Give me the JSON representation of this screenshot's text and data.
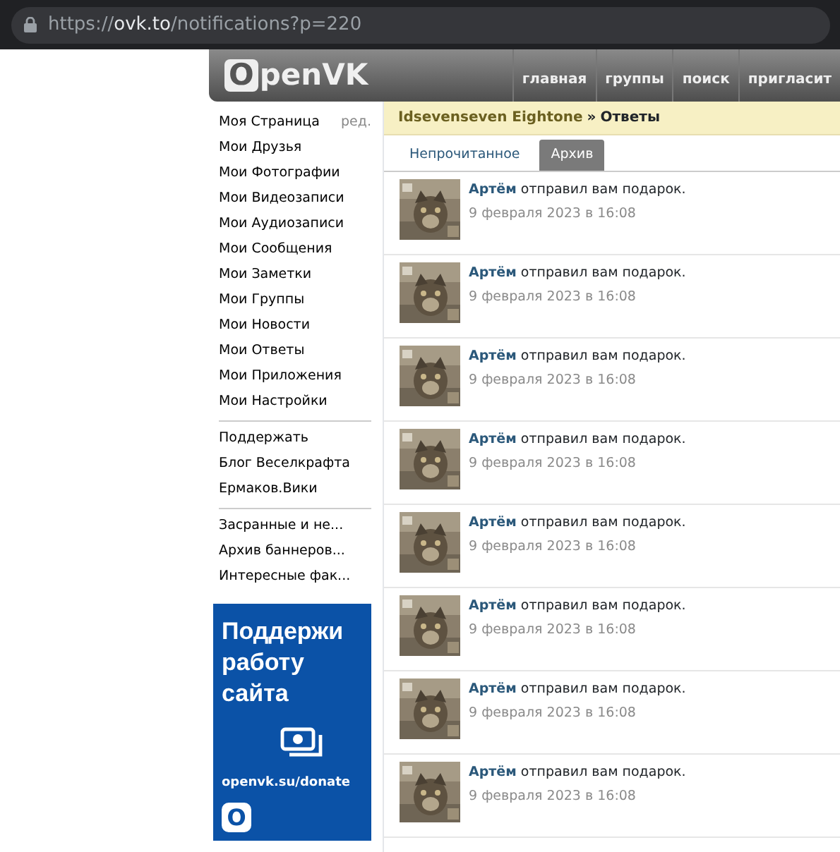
{
  "browser": {
    "url": {
      "scheme": "https://",
      "host": "ovk.to",
      "path": "/notifications?p=220"
    }
  },
  "header": {
    "logo": "OpenVK",
    "nav": [
      {
        "label": "главная"
      },
      {
        "label": "группы"
      },
      {
        "label": "поиск"
      },
      {
        "label": "пригласит"
      }
    ]
  },
  "sidebar": {
    "groups": [
      [
        {
          "label": "Моя Страница",
          "edit": "ред."
        },
        {
          "label": "Мои Друзья"
        },
        {
          "label": "Мои Фотографии"
        },
        {
          "label": "Мои Видеозаписи"
        },
        {
          "label": "Мои Аудиозаписи"
        },
        {
          "label": "Мои Сообщения"
        },
        {
          "label": "Мои Заметки"
        },
        {
          "label": "Мои Группы"
        },
        {
          "label": "Мои Новости"
        },
        {
          "label": "Мои Ответы"
        },
        {
          "label": "Мои Приложения"
        },
        {
          "label": "Мои Настройки"
        }
      ],
      [
        {
          "label": "Поддержать"
        },
        {
          "label": "Блог Веселкрафта"
        },
        {
          "label": "Ермаков.Вики"
        }
      ],
      [
        {
          "label": "Засранные и не..."
        },
        {
          "label": "Архив баннеров..."
        },
        {
          "label": "Интересные фак..."
        }
      ]
    ],
    "banner": {
      "title": "Поддержи работу сайта",
      "url": "openvk.su/donate",
      "logo_letter": "O"
    }
  },
  "breadcrumb": {
    "user": "Idsevenseven Eightone",
    "separator": "»",
    "page": "Ответы"
  },
  "tabs": [
    {
      "label": "Непрочитанное",
      "selected": false
    },
    {
      "label": "Архив",
      "selected": true
    }
  ],
  "notifications": [
    {
      "author": "Артём",
      "text": "отправил вам подарок.",
      "time": "9 февраля 2023 в 16:08"
    },
    {
      "author": "Артём",
      "text": "отправил вам подарок.",
      "time": "9 февраля 2023 в 16:08"
    },
    {
      "author": "Артём",
      "text": "отправил вам подарок.",
      "time": "9 февраля 2023 в 16:08"
    },
    {
      "author": "Артём",
      "text": "отправил вам подарок.",
      "time": "9 февраля 2023 в 16:08"
    },
    {
      "author": "Артём",
      "text": "отправил вам подарок.",
      "time": "9 февраля 2023 в 16:08"
    },
    {
      "author": "Артём",
      "text": "отправил вам подарок.",
      "time": "9 февраля 2023 в 16:08"
    },
    {
      "author": "Артём",
      "text": "отправил вам подарок.",
      "time": "9 февраля 2023 в 16:08"
    },
    {
      "author": "Артём",
      "text": "отправил вам подарок.",
      "time": "9 февраля 2023 в 16:08"
    }
  ]
}
